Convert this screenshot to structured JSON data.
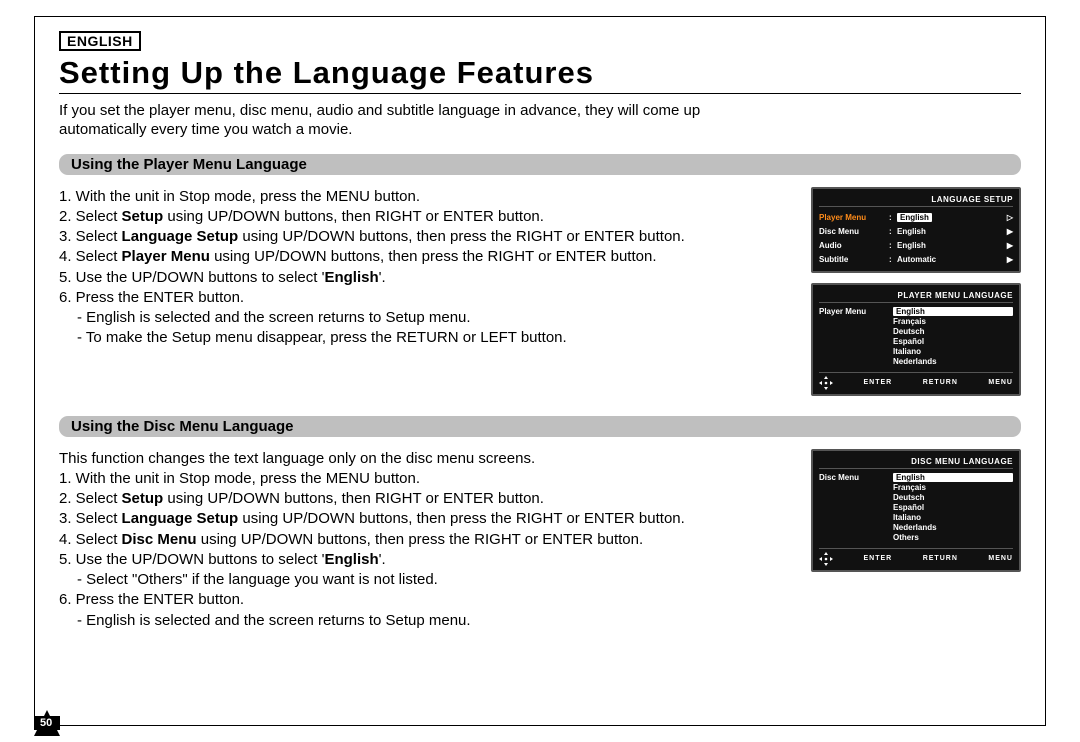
{
  "header": {
    "langBox": "ENGLISH",
    "title": "Setting Up the Language Features",
    "intro1": "If you set the player menu, disc menu, audio and subtitle language in advance, they will come up",
    "intro2": "automatically every time you watch a movie."
  },
  "section1": {
    "bar": "Using the Player Menu Language",
    "s1": "1. With the unit in Stop mode, press the MENU button.",
    "s2a": "2. Select ",
    "s2b": "Setup",
    "s2c": " using UP/DOWN buttons, then RIGHT or ENTER button.",
    "s3a": "3. Select ",
    "s3b": "Language Setup",
    "s3c": " using UP/DOWN buttons, then press the RIGHT or ENTER button.",
    "s4a": "4. Select ",
    "s4b": "Player Menu",
    "s4c": " using UP/DOWN buttons, then press the RIGHT or ENTER button.",
    "s5a": "5. Use the UP/DOWN buttons to select '",
    "s5b": "English",
    "s5c": "'.",
    "s6": "6. Press the ENTER button.",
    "s6a": "- English is selected and the screen returns to Setup menu.",
    "s6b": "- To make the Setup menu disappear, press the RETURN or LEFT button.",
    "tv1": {
      "title": "LANGUAGE SETUP",
      "rows": [
        {
          "label": "Player Menu",
          "value": "English",
          "sel": true,
          "arr": "▷"
        },
        {
          "label": "Disc Menu",
          "value": "English",
          "sel": false,
          "arr": "▶"
        },
        {
          "label": "Audio",
          "value": "English",
          "sel": false,
          "arr": "▶"
        },
        {
          "label": "Subtitle",
          "value": "Automatic",
          "sel": false,
          "arr": "▶"
        }
      ]
    },
    "tv2": {
      "title": "PLAYER MENU LANGUAGE",
      "label": "Player Menu",
      "langs": [
        {
          "name": "English",
          "sel": true
        },
        {
          "name": "Français",
          "sel": false
        },
        {
          "name": "Deutsch",
          "sel": false
        },
        {
          "name": "Español",
          "sel": false
        },
        {
          "name": "Italiano",
          "sel": false
        },
        {
          "name": "Nederlands",
          "sel": false
        }
      ],
      "footer": {
        "enter": "ENTER",
        "return": "RETURN",
        "menu": "MENU"
      }
    }
  },
  "section2": {
    "bar": "Using the Disc Menu Language",
    "lead": "This function changes the text language only on the disc menu screens.",
    "s1": "1. With the unit in Stop mode, press the MENU button.",
    "s2a": "2. Select ",
    "s2b": "Setup",
    "s2c": " using UP/DOWN buttons, then RIGHT or ENTER button.",
    "s3a": "3. Select ",
    "s3b": "Language Setup",
    "s3c": " using UP/DOWN buttons, then press the RIGHT or ENTER button.",
    "s4a": "4. Select ",
    "s4b": "Disc Menu",
    "s4c": " using UP/DOWN buttons, then press the RIGHT or ENTER button.",
    "s5a": "5. Use the UP/DOWN buttons to select '",
    "s5b": "English",
    "s5c": "'.",
    "s5d": "- Select \"Others\" if the language you want is not listed.",
    "s6": "6. Press the ENTER button.",
    "s6a": "- English is selected and the screen returns to Setup menu.",
    "tv": {
      "title": "DISC MENU LANGUAGE",
      "label": "Disc Menu",
      "langs": [
        {
          "name": "English",
          "sel": true
        },
        {
          "name": "Français",
          "sel": false
        },
        {
          "name": "Deutsch",
          "sel": false
        },
        {
          "name": "Español",
          "sel": false
        },
        {
          "name": "Italiano",
          "sel": false
        },
        {
          "name": "Nederlands",
          "sel": false
        },
        {
          "name": "Others",
          "sel": false
        }
      ],
      "footer": {
        "enter": "ENTER",
        "return": "RETURN",
        "menu": "MENU"
      }
    }
  },
  "pageNumber": "50"
}
